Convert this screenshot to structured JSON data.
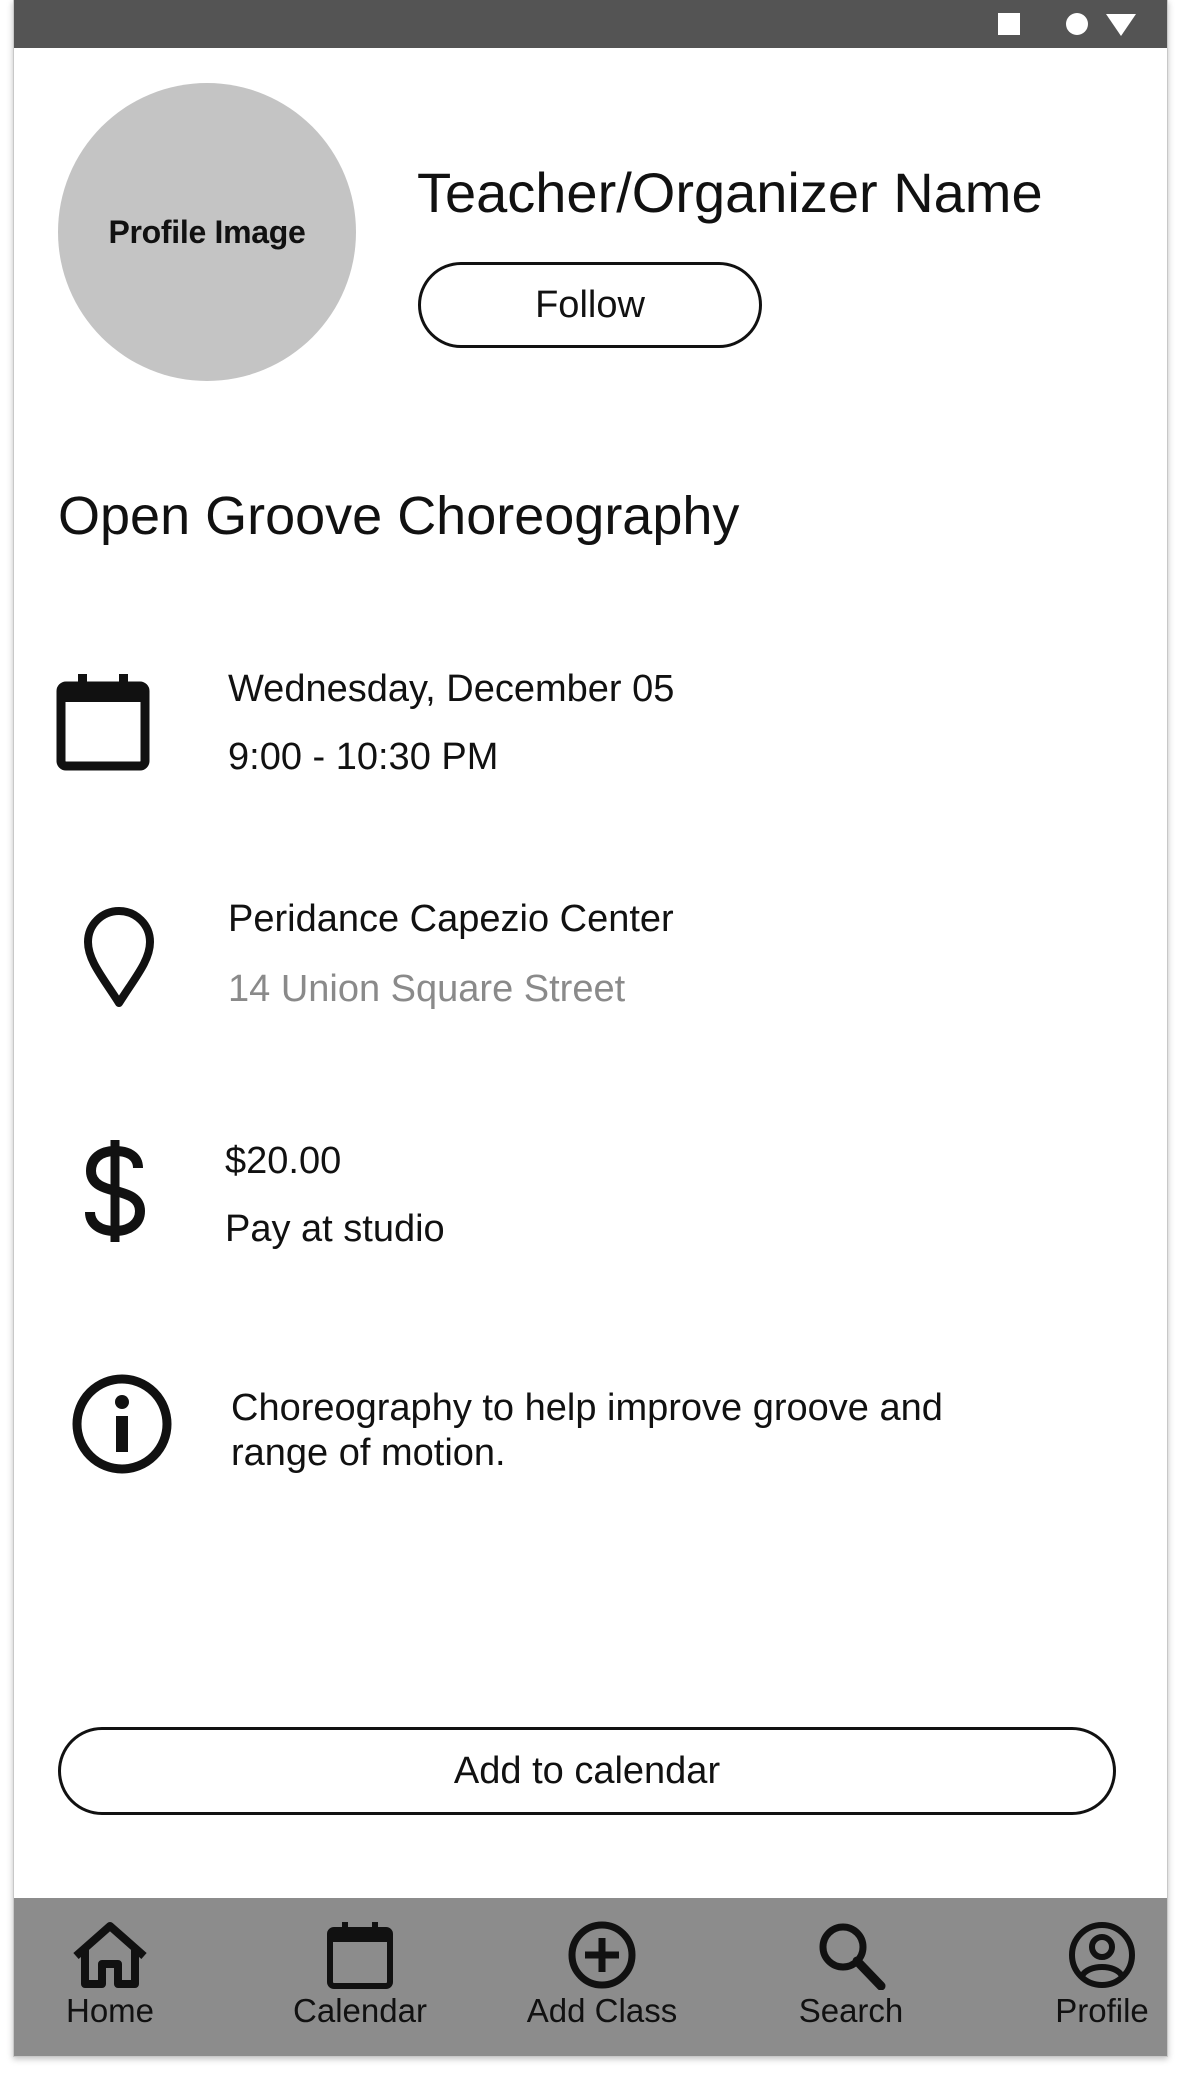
{
  "profile": {
    "image_placeholder": "Profile Image",
    "name": "Teacher/Organizer Name",
    "follow_label": "Follow"
  },
  "event": {
    "title": "Open Groove Choreography",
    "date": "Wednesday, December 05",
    "time": "9:00 - 10:30 PM",
    "venue": "Peridance Capezio Center",
    "address": "14 Union Square Street",
    "price": "$20.00",
    "payment_note": "Pay at studio",
    "description_line1": "Choreography to help improve groove and",
    "description_line2": "range of motion."
  },
  "actions": {
    "add_to_calendar_label": "Add to calendar"
  },
  "nav": {
    "items": [
      {
        "label": "Home",
        "icon": "home-icon"
      },
      {
        "label": "Calendar",
        "icon": "calendar-icon"
      },
      {
        "label": "Add Class",
        "icon": "add-circle-icon"
      },
      {
        "label": "Search",
        "icon": "search-icon"
      },
      {
        "label": "Profile",
        "icon": "profile-icon"
      }
    ]
  },
  "colors": {
    "status_bar": "#545454",
    "bottom_nav": "#8c8c8c",
    "avatar": "#c4c4c4",
    "muted_text": "#8a8a8a",
    "text": "#111111"
  }
}
